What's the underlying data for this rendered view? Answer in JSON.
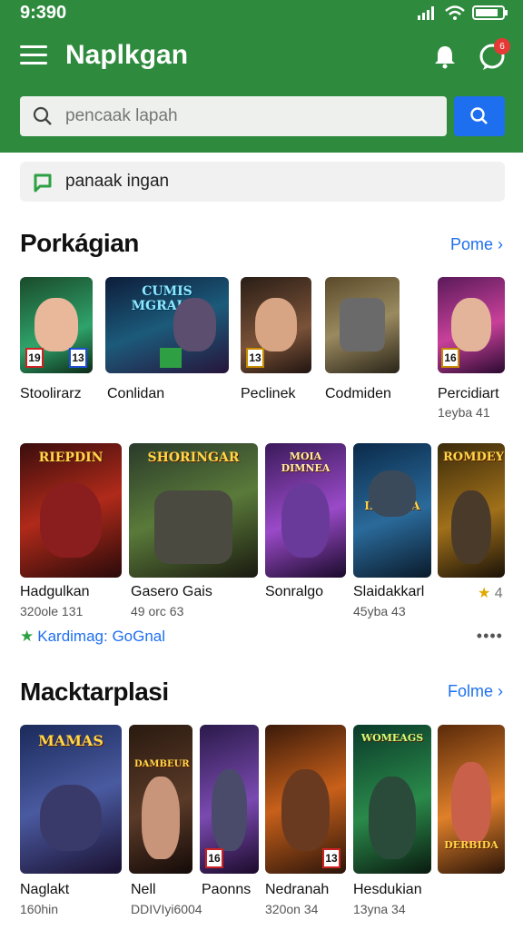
{
  "status_bar": {
    "time": "9:390"
  },
  "header": {
    "title": "Naplkgan",
    "notification_badge": "6",
    "search_placeholder": "pencaak lapah"
  },
  "chip": {
    "label": "panaak ingan"
  },
  "section1": {
    "title": "Porkágian",
    "more": "Pome ›",
    "row1": [
      {
        "name": "Stoolirarz",
        "sub": "",
        "tag_left": "19",
        "tag_right": "13"
      },
      {
        "name": "Conlidan",
        "sub": "",
        "overlay": "CUMIS MGRAKIS"
      },
      {
        "name": "Peclinek",
        "sub": "",
        "tag_left": "13"
      },
      {
        "name": "Codmiden",
        "sub": ""
      },
      {
        "name": "Percidiart",
        "sub": "1eyba 41",
        "tag_left": "16"
      }
    ],
    "row2": [
      {
        "name": "Hadgulkan",
        "sub": "320ole 131",
        "overlay": "RIEPDIN"
      },
      {
        "name": "Gasero Gais",
        "sub": "49 orc 63",
        "overlay": "SHORINGAR"
      },
      {
        "name": "Sonralgo",
        "sub": "",
        "overlay": "MOIA DIMNEA"
      },
      {
        "name": "Slaidakkarl",
        "sub": "45yba 43",
        "overlay": "INDIARA"
      },
      {
        "name": "4",
        "sub": "",
        "overlay": "ROMDEY"
      }
    ],
    "promo": "Kardimag: GoGnal",
    "dots": "••••"
  },
  "section2": {
    "title": "Macktarplasi",
    "more": "Folme ›",
    "row": [
      {
        "name": "Naglakt",
        "sub": "160hin",
        "overlay": "MAMAS"
      },
      {
        "name": "Nell",
        "sub": "DDIVIyi6004",
        "overlay": "DAMBEUR"
      },
      {
        "name": "Paonns",
        "sub": "",
        "tag_left": "16"
      },
      {
        "name": "Nedranah",
        "sub": "320on 34",
        "tag_left": "13"
      },
      {
        "name": "Hesdukian",
        "sub": "13yna 34",
        "overlay": "WOMEAGS"
      },
      {
        "name": "",
        "sub": "",
        "overlay": "DERBIDA"
      }
    ]
  },
  "colors": {
    "header": "#2e8b3e",
    "accent": "#1e6ff0",
    "promo_star": "#2ea043"
  }
}
